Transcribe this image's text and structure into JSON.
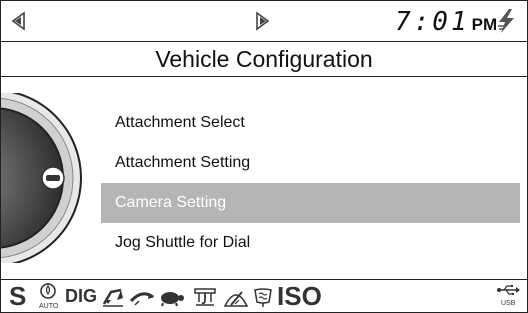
{
  "header": {
    "time": "7:01",
    "ampm": "PM",
    "nav_left_icon": "left-arrow-icon",
    "nav_right_icon": "right-arrow-icon",
    "power_icon": "lightning-bolt-icon"
  },
  "title": "Vehicle Configuration",
  "menu": {
    "items": [
      {
        "label": "Attachment Select",
        "selected": false
      },
      {
        "label": "Attachment Setting",
        "selected": false
      },
      {
        "label": "Camera Setting",
        "selected": true
      },
      {
        "label": "Jog Shuttle for Dial",
        "selected": false
      }
    ]
  },
  "status": {
    "s_label": "S",
    "auto_label": "AUTO",
    "dig_label": "DIG",
    "iso_label": "ISO",
    "usb_label": "USB"
  },
  "colors": {
    "selection": "#b5b5b5",
    "text": "#111111",
    "icon": "#333333"
  }
}
